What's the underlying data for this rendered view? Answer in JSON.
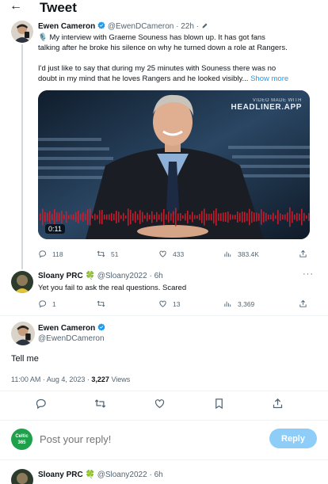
{
  "header": {
    "back_glyph": "←",
    "title": "Tweet"
  },
  "tweets": [
    {
      "name": "Ewen Cameron",
      "handle": "@EwenDCameron",
      "time": "· 22h ·",
      "text_line1": "🎙️ My interview with Graeme Souness has blown up. It has got fans",
      "text_line2": "talking after he broke his silence on why he turned down a role at Rangers.",
      "text_line3": "I'd just like to say that during my 25 minutes with Souness there was no",
      "text_line4": "doubt in my mind that he loves Rangers and he looked visibly...",
      "show_more": "Show more",
      "media": {
        "watermark_top": "VIDEO MADE WITH",
        "watermark_brand": "HEADLINER.APP",
        "duration": "0:11"
      },
      "stats": {
        "replies": "118",
        "retweets": "51",
        "likes": "433",
        "views": "383.4K"
      }
    },
    {
      "name": "Sloany PRC",
      "badge": "🍀",
      "handle": "@Sloany2022",
      "time": "· 6h",
      "text": "Yet you fail to ask the real questions. Scared",
      "stats": {
        "replies": "1",
        "retweets": "",
        "likes": "13",
        "views": "3,369"
      }
    }
  ],
  "main_tweet": {
    "name": "Ewen Cameron",
    "handle": "@EwenDCameron",
    "text": "Tell me",
    "time": "11:00 AM · Aug 4, 2023 · ",
    "views_count": "3,227",
    "views_label": " Views"
  },
  "reply": {
    "avatar_text_top": "Celtic",
    "avatar_text_bottom": "365",
    "placeholder": "Post your reply!",
    "button": "Reply"
  },
  "next_tweet": {
    "name": "Sloany PRC",
    "badge": "🍀",
    "handle": "@Sloany2022",
    "time": "· 6h"
  },
  "colors": {
    "accent": "#1d9bf0",
    "text": "#0f1419",
    "muted": "#536471",
    "reply_button": "#8ecdf8",
    "waveform": "#d01f2f"
  },
  "icons": [
    "back-arrow-icon",
    "verified-icon",
    "reply-icon",
    "retweet-icon",
    "like-icon",
    "views-icon",
    "share-icon",
    "bookmark-icon",
    "more-icon"
  ]
}
